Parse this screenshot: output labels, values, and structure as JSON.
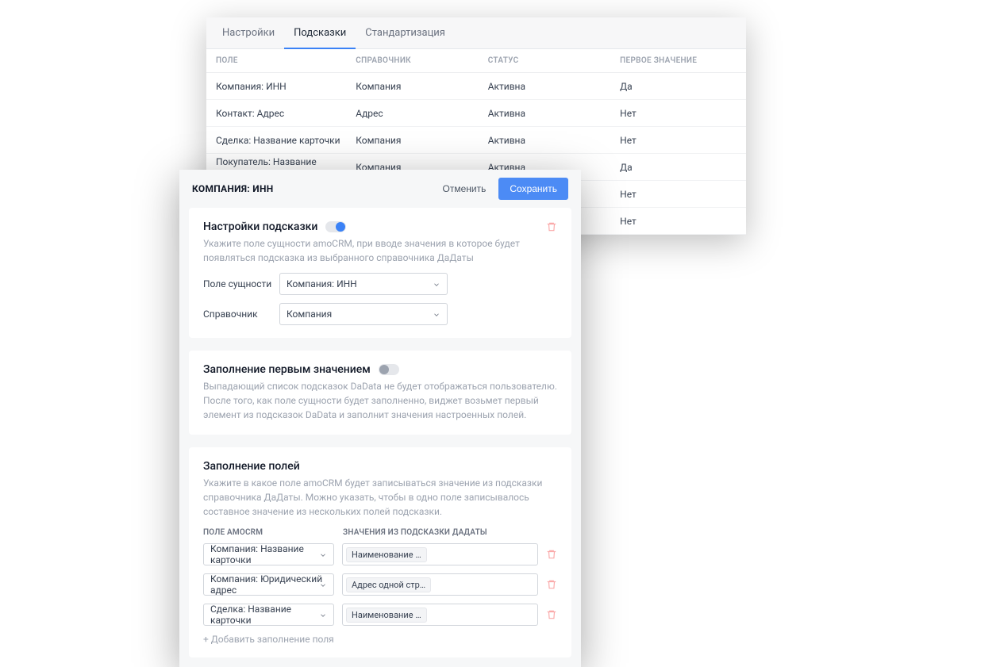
{
  "tabs": {
    "settings": "Настройки",
    "hints": "Подсказки",
    "standardization": "Стандартизация"
  },
  "back_table": {
    "headers": {
      "field": "ПОЛЕ",
      "reference": "СПРАВОЧНИК",
      "status": "СТАТУС",
      "first_value": "ПЕРВОЕ ЗНАЧЕНИЕ"
    },
    "rows": [
      {
        "field": "Компания: ИНН",
        "reference": "Компания",
        "status": "Активна",
        "first_value": "Да"
      },
      {
        "field": "Контакт: Адрес",
        "reference": "Адрес",
        "status": "Активна",
        "first_value": "Нет"
      },
      {
        "field": "Сделка: Название карточки",
        "reference": "Компания",
        "status": "Активна",
        "first_value": "Нет"
      },
      {
        "field": "Покупатель: Название карточки",
        "reference": "Компания",
        "status": "Активна",
        "first_value": "Да"
      },
      {
        "field": "",
        "reference": "",
        "status": "",
        "first_value": "Нет"
      },
      {
        "field": "",
        "reference": "",
        "status": "",
        "first_value": "Нет"
      }
    ]
  },
  "front": {
    "title": "КОМПАНИЯ: ИНН",
    "cancel": "Отменить",
    "save": "Сохранить"
  },
  "section_hint": {
    "title": "Настройки подсказки",
    "desc": "Укажите поле сущности amoCRM, при вводе значения в которое будет появляться подсказка из выбранного справочника ДаДаты",
    "field_label": "Поле сущности",
    "field_value": "Компания: ИНН",
    "ref_label": "Справочник",
    "ref_value": "Компания"
  },
  "section_first": {
    "title": "Заполнение первым значением",
    "desc": "Выпадающий список подсказок DaData не будет отображаться пользователю. После того, как поле сущности будет заполненно, виджет возьмет первый элемент из подсказок DaData и заполнит значения настроенных полей."
  },
  "section_fill": {
    "title": "Заполнение полей",
    "desc": "Укажите в какое поле amoCRM будет записываться значение из подсказки справочника ДаДаты. Можно указать, чтобы в одно поле записывалось составное значение из нескольких полей подсказки.",
    "head_field": "ПОЛЕ AMOCRM",
    "head_value": "ЗНАЧЕНИЯ ИЗ ПОДСКАЗКИ ДАДАТЫ",
    "rows": [
      {
        "field": "Компания: Название карточки",
        "chip": "Наименование …"
      },
      {
        "field": "Компания: Юридический адрес",
        "chip": "Адрес одной стр…"
      },
      {
        "field": "Сделка: Название карточки",
        "chip": "Наименование …"
      }
    ],
    "add_link": "+ Добавить заполнение поля"
  }
}
